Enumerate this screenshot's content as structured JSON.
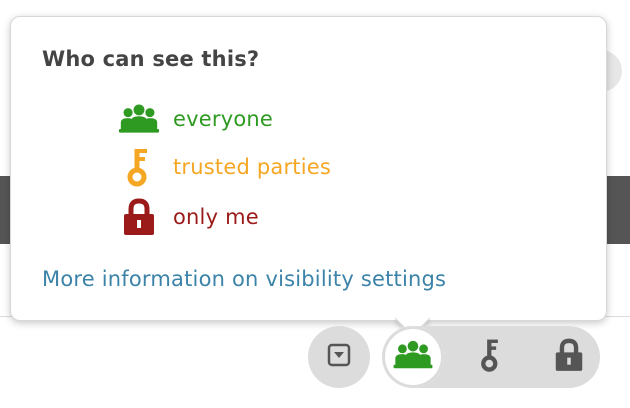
{
  "popover": {
    "title": "Who can see this?",
    "options": [
      {
        "label": "everyone",
        "icon": "group-icon",
        "color": "#2e9a22"
      },
      {
        "label": "trusted parties",
        "icon": "key-icon",
        "color": "#f5a623"
      },
      {
        "label": "only me",
        "icon": "lock-icon",
        "color": "#9b1b1b"
      }
    ],
    "more_link": "More information on visibility settings",
    "link_color": "#3b83a8"
  },
  "toolbar": {
    "dropdown_icon": "dropdown-arrow-icon",
    "selected": "everyone",
    "buttons": [
      {
        "icon": "group-icon",
        "active": true
      },
      {
        "icon": "key-icon",
        "active": false
      },
      {
        "icon": "lock-icon",
        "active": false
      }
    ]
  }
}
